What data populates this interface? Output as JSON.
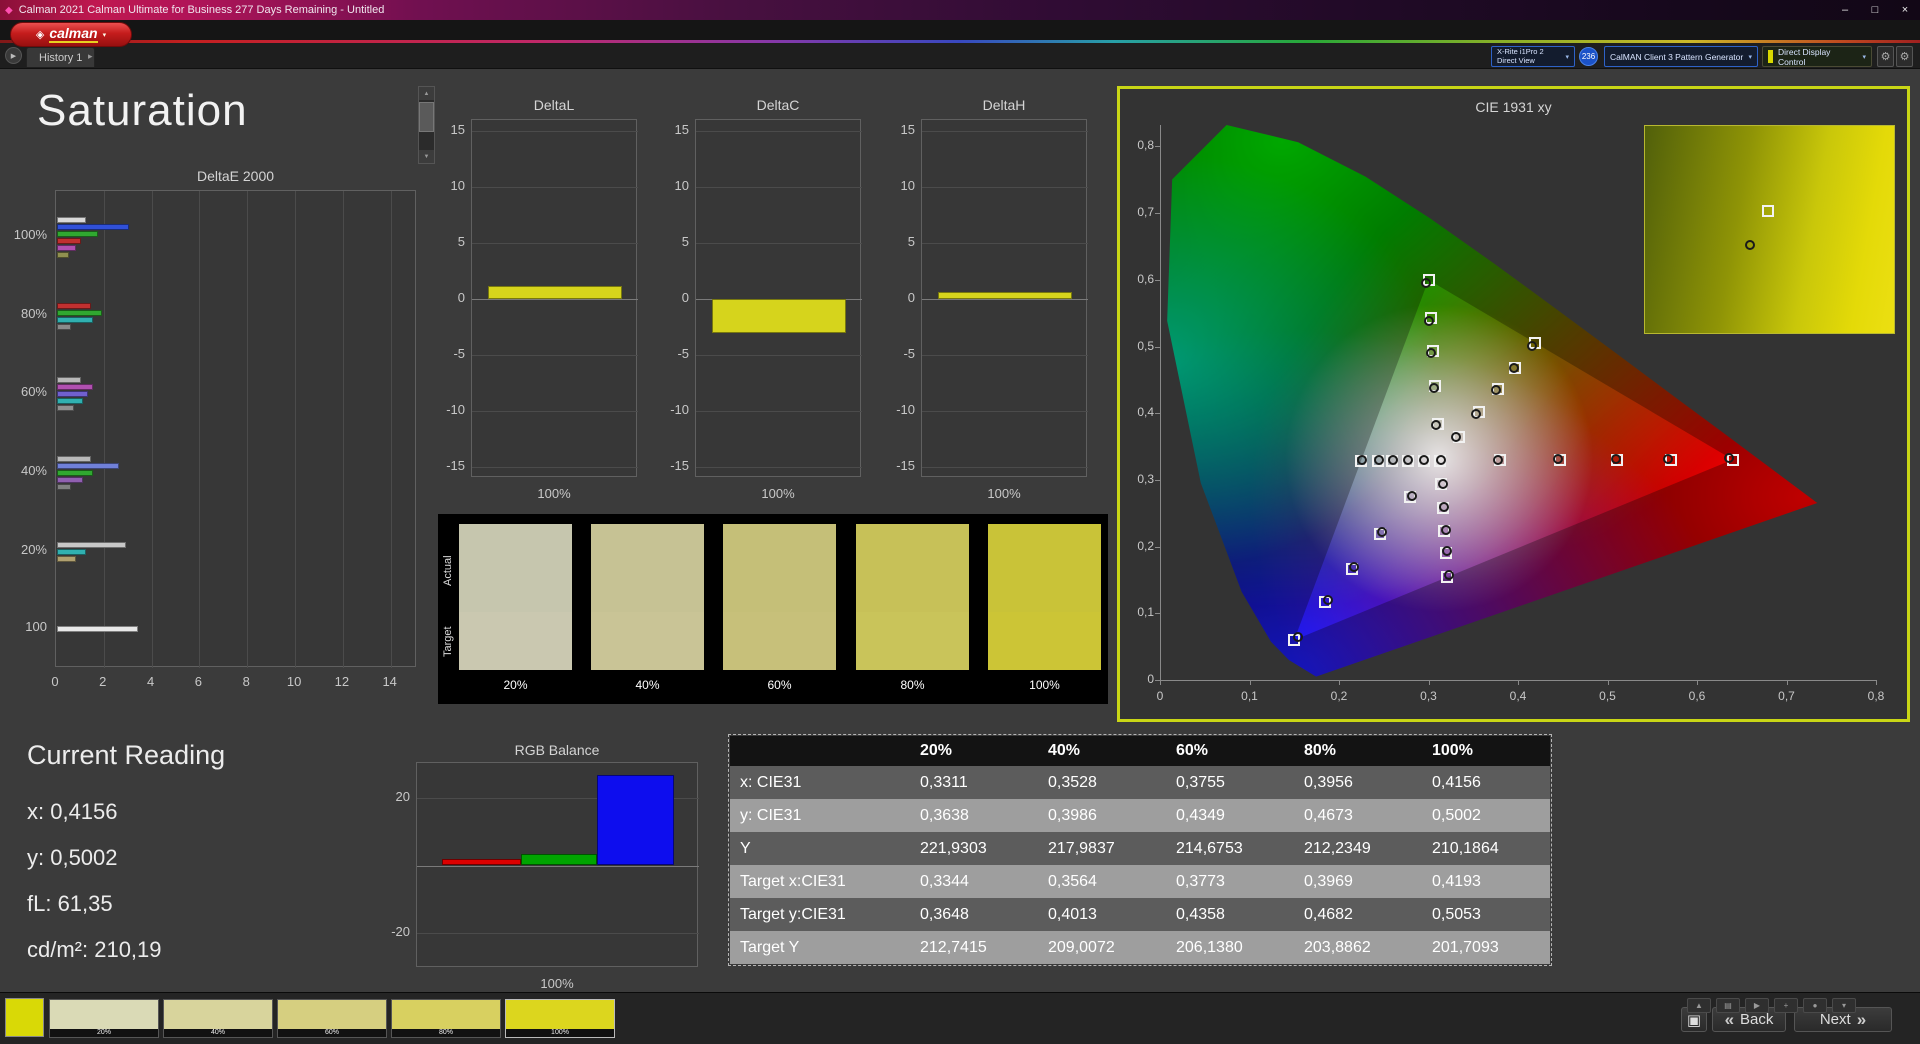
{
  "window": {
    "title": "Calman 2021 Calman Ultimate for Business 277 Days Remaining  - Untitled"
  },
  "menubar": {
    "logo": "calman"
  },
  "tabstrip": {
    "history_tab": "History 1",
    "meter": {
      "line1": "X-Rite i1Pro 2",
      "line2": "Direct View"
    },
    "meter_badge": "236",
    "pattern_generator": "CalMAN Client 3 Pattern Generator",
    "display_control": "Direct Display Control"
  },
  "page": {
    "title": "Saturation"
  },
  "icons": {
    "app": "◆",
    "minimize": "–",
    "maximize": "□",
    "close": "×",
    "logo_mark": "◈",
    "logo_dropdown": "▾",
    "history_play": "▶",
    "history_dropdown": "▸",
    "dropdown": "▾",
    "gear": "⚙",
    "scroll_up": "▲",
    "scroll_down": "▼",
    "back": "«",
    "next": "»",
    "pattern_window": "▣",
    "toolbar": [
      "▲",
      "▤",
      "▶",
      "+",
      "●",
      "▾"
    ]
  },
  "current_reading": {
    "title": "Current Reading",
    "items": [
      {
        "label": "x:",
        "value": "0,4156"
      },
      {
        "label": "y:",
        "value": "0,5002"
      },
      {
        "label": "fL:",
        "value": "61,35"
      },
      {
        "label": "cd/m²:",
        "value": "210,19"
      }
    ]
  },
  "nav": {
    "back": "Back",
    "next": "Next"
  },
  "pattern_strip": {
    "labels": [
      "20%",
      "40%",
      "60%",
      "80%",
      "100%"
    ],
    "colors": [
      "#dadab6",
      "#d8d49c",
      "#d6cf80",
      "#d8d060",
      "#dcd61e"
    ],
    "selected": "100%"
  },
  "chart_data": [
    {
      "id": "deltae",
      "type": "bar",
      "orientation": "horizontal",
      "title": "DeltaE 2000",
      "xlim": [
        0,
        15.1
      ],
      "xticks": [
        0,
        2,
        4,
        6,
        8,
        10,
        12,
        14
      ],
      "groups": [
        {
          "label": "100%",
          "bars": [
            {
              "color": "#d8d8d8",
              "value": 1.2
            },
            {
              "color": "#3050d8",
              "value": 3.0
            },
            {
              "color": "#30a830",
              "value": 1.7
            },
            {
              "color": "#c03030",
              "value": 1.0
            },
            {
              "color": "#b050b0",
              "value": 0.8
            },
            {
              "color": "#909050",
              "value": 0.5
            }
          ]
        },
        {
          "label": "80%",
          "bars": [
            {
              "color": "#c03030",
              "value": 1.4
            },
            {
              "color": "#30a830",
              "value": 1.9
            },
            {
              "color": "#30b0b0",
              "value": 1.5
            },
            {
              "color": "#8a8a8a",
              "value": 0.6
            }
          ]
        },
        {
          "label": "60%",
          "bars": [
            {
              "color": "#b8b8b8",
              "value": 1.0
            },
            {
              "color": "#b050b0",
              "value": 1.5
            },
            {
              "color": "#7060d0",
              "value": 1.3
            },
            {
              "color": "#30b0b0",
              "value": 1.1
            },
            {
              "color": "#909090",
              "value": 0.7
            }
          ]
        },
        {
          "label": "40%",
          "bars": [
            {
              "color": "#b8b8b8",
              "value": 1.4
            },
            {
              "color": "#7080d8",
              "value": 2.6
            },
            {
              "color": "#30a830",
              "value": 1.5
            },
            {
              "color": "#9060b0",
              "value": 1.1
            },
            {
              "color": "#808080",
              "value": 0.6
            }
          ]
        },
        {
          "label": "20%",
          "bars": [
            {
              "color": "#c8c8c8",
              "value": 2.9
            },
            {
              "color": "#30b0b0",
              "value": 1.2
            },
            {
              "color": "#b0a070",
              "value": 0.8
            }
          ]
        },
        {
          "label": "100",
          "bars": [
            {
              "color": "#e8e8e8",
              "value": 3.4
            }
          ]
        }
      ]
    },
    {
      "id": "deltaL",
      "type": "bar",
      "title": "DeltaL",
      "ylim": [
        -15,
        15
      ],
      "yticks": [
        15,
        10,
        5,
        0,
        -5,
        -10,
        -15
      ],
      "categories": [
        "100%"
      ],
      "values": [
        1.2
      ],
      "bar_color": "#d6d41c"
    },
    {
      "id": "deltaC",
      "type": "bar",
      "title": "DeltaC",
      "ylim": [
        -15,
        15
      ],
      "yticks": [
        15,
        10,
        5,
        0,
        -5,
        -10,
        -15
      ],
      "categories": [
        "100%"
      ],
      "values": [
        -3.0
      ],
      "bar_color": "#d6d41c"
    },
    {
      "id": "deltaH",
      "type": "bar",
      "title": "DeltaH",
      "ylim": [
        -15,
        15
      ],
      "yticks": [
        15,
        10,
        5,
        0,
        -5,
        -10,
        -15
      ],
      "categories": [
        "100%"
      ],
      "values": [
        0.6
      ],
      "bar_color": "#d6d41c"
    },
    {
      "id": "rgb",
      "type": "bar",
      "title": "RGB Balance",
      "ylim": [
        -30,
        30
      ],
      "yticks": [
        20,
        -20
      ],
      "categories": [
        "100%"
      ],
      "series": [
        {
          "name": "Red",
          "color": "#dd0000",
          "value": 2.0
        },
        {
          "name": "Green",
          "color": "#00a400",
          "value": 3.5
        },
        {
          "name": "Blue",
          "color": "#0d0dee",
          "value": 27.0
        }
      ]
    },
    {
      "id": "sat-swatches",
      "type": "table",
      "title": "Saturation Swatches",
      "row_labels": [
        "Actual",
        "Target"
      ],
      "columns": [
        "20%",
        "40%",
        "60%",
        "80%",
        "100%"
      ],
      "actual_colors": [
        "#c6c6ae",
        "#c6c294",
        "#c5bf78",
        "#c7c158",
        "#c9c338"
      ],
      "target_colors": [
        "#cac8b0",
        "#c9c496",
        "#c7c07a",
        "#c9c45a",
        "#ccc536"
      ]
    },
    {
      "id": "cie",
      "type": "scatter",
      "title": "CIE 1931 xy",
      "xlim": [
        0,
        0.8
      ],
      "ylim": [
        0,
        0.832
      ],
      "xticks": [
        "0",
        "0,1",
        "0,2",
        "0,3",
        "0,4",
        "0,5",
        "0,6",
        "0,7",
        "0,8"
      ],
      "yticks": [
        "0",
        "0,1",
        "0,2",
        "0,3",
        "0,4",
        "0,5",
        "0,6",
        "0,7",
        "0,8"
      ],
      "white_target": [
        0.3127,
        0.329
      ],
      "white_measured": [
        0.3139,
        0.3302
      ],
      "sweeps": [
        {
          "name": "red",
          "targets": [
            [
              0.3795,
              0.3292
            ],
            [
              0.4469,
              0.3294
            ],
            [
              0.5111,
              0.3296
            ],
            [
              0.5713,
              0.3298
            ],
            [
              0.64,
              0.33
            ]
          ],
          "measured": [
            [
              0.378,
              0.3304
            ],
            [
              0.4451,
              0.331
            ],
            [
              0.509,
              0.3314
            ],
            [
              0.568,
              0.332
            ],
            [
              0.636,
              0.3328
            ]
          ]
        },
        {
          "name": "green",
          "targets": [
            [
              0.3101,
              0.3843
            ],
            [
              0.3075,
              0.4401
            ],
            [
              0.305,
              0.4932
            ],
            [
              0.3027,
              0.5431
            ],
            [
              0.3,
              0.6
            ]
          ],
          "measured": [
            [
              0.3088,
              0.382
            ],
            [
              0.3057,
              0.4371
            ],
            [
              0.3031,
              0.49
            ],
            [
              0.3008,
              0.539
            ],
            [
              0.2974,
              0.5952
            ]
          ]
        },
        {
          "name": "blue",
          "targets": [
            [
              0.2795,
              0.2741
            ],
            [
              0.246,
              0.2187
            ],
            [
              0.2141,
              0.166
            ],
            [
              0.1842,
              0.1165
            ],
            [
              0.15,
              0.06
            ]
          ],
          "measured": [
            [
              0.2812,
              0.2757
            ],
            [
              0.2484,
              0.2212
            ],
            [
              0.2167,
              0.1691
            ],
            [
              0.1872,
              0.12
            ],
            [
              0.1537,
              0.0638
            ]
          ]
        },
        {
          "name": "cyan",
          "targets": [
            [
              0.2947,
              0.3289
            ],
            [
              0.2766,
              0.3289
            ],
            [
              0.2593,
              0.3288
            ],
            [
              0.2431,
              0.3288
            ],
            [
              0.2246,
              0.3287
            ]
          ],
          "measured": [
            [
              0.2954,
              0.3296
            ],
            [
              0.2775,
              0.3297
            ],
            [
              0.2604,
              0.3297
            ],
            [
              0.2444,
              0.3298
            ],
            [
              0.2262,
              0.3299
            ]
          ]
        },
        {
          "name": "magenta",
          "targets": [
            [
              0.3144,
              0.2933
            ],
            [
              0.3161,
              0.2573
            ],
            [
              0.3177,
              0.2231
            ],
            [
              0.3192,
              0.1909
            ],
            [
              0.3209,
              0.1542
            ]
          ],
          "measured": [
            [
              0.3157,
              0.2944
            ],
            [
              0.3176,
              0.2588
            ],
            [
              0.3194,
              0.225
            ],
            [
              0.3211,
              0.1931
            ],
            [
              0.323,
              0.1569
            ]
          ]
        },
        {
          "name": "yellow",
          "targets": [
            [
              0.3344,
              0.3648
            ],
            [
              0.3564,
              0.4013
            ],
            [
              0.3773,
              0.4358
            ],
            [
              0.3969,
              0.4682
            ],
            [
              0.4193,
              0.5053
            ]
          ],
          "measured": [
            [
              0.3311,
              0.3638
            ],
            [
              0.3528,
              0.3986
            ],
            [
              0.3755,
              0.4349
            ],
            [
              0.3956,
              0.4673
            ],
            [
              0.4156,
              0.5002
            ]
          ]
        }
      ]
    },
    {
      "id": "sat-table",
      "type": "table",
      "columns": [
        "",
        "20%",
        "40%",
        "60%",
        "80%",
        "100%"
      ],
      "rows": [
        {
          "label": "x: CIE31",
          "values": [
            "0,3311",
            "0,3528",
            "0,3755",
            "0,3956",
            "0,4156"
          ]
        },
        {
          "label": "y: CIE31",
          "values": [
            "0,3638",
            "0,3986",
            "0,4349",
            "0,4673",
            "0,5002"
          ]
        },
        {
          "label": "Y",
          "values": [
            "221,9303",
            "217,9837",
            "214,6753",
            "212,2349",
            "210,1864"
          ]
        },
        {
          "label": "Target x:CIE31",
          "values": [
            "0,3344",
            "0,3564",
            "0,3773",
            "0,3969",
            "0,4193"
          ]
        },
        {
          "label": "Target y:CIE31",
          "values": [
            "0,3648",
            "0,4013",
            "0,4358",
            "0,4682",
            "0,5053"
          ]
        },
        {
          "label": "Target Y",
          "values": [
            "212,7415",
            "209,0072",
            "206,1380",
            "203,8862",
            "201,7093"
          ]
        }
      ]
    }
  ]
}
